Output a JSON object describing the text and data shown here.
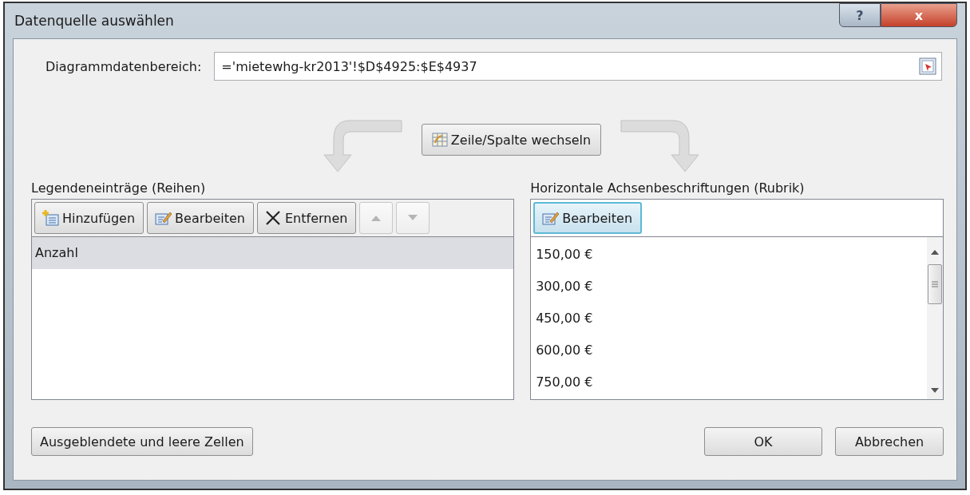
{
  "window": {
    "title": "Datenquelle auswählen",
    "help_button": "?",
    "close_button": "x"
  },
  "range": {
    "label": "Diagrammdatenbereich:",
    "value": "='mietewhg-kr2013'!$D$4925:$E$4937"
  },
  "switch_button": "Zeile/Spalte wechseln",
  "series": {
    "label": "Legendeneinträge (Reihen)",
    "buttons": [
      {
        "kind": "add",
        "label": "Hinzufügen"
      },
      {
        "kind": "edit",
        "label": "Bearbeiten"
      },
      {
        "kind": "remove",
        "label": "Entfernen"
      },
      {
        "kind": "up",
        "disabled": true
      },
      {
        "kind": "down",
        "disabled": true
      }
    ],
    "items": [
      {
        "label": "Anzahl",
        "selected": true
      }
    ]
  },
  "categories": {
    "label": "Horizontale Achsenbeschriftungen (Rubrik)",
    "edit_button": {
      "label": "Bearbeiten",
      "focused": true
    },
    "items": [
      {
        "label": "150,00 €"
      },
      {
        "label": "300,00 €"
      },
      {
        "label": "450,00 €"
      },
      {
        "label": "600,00 €"
      },
      {
        "label": "750,00 €"
      }
    ]
  },
  "footer": {
    "hidden_cells_button": "Ausgeblendete und leere Zellen",
    "ok_button": "OK",
    "cancel_button": "Abbrechen"
  }
}
